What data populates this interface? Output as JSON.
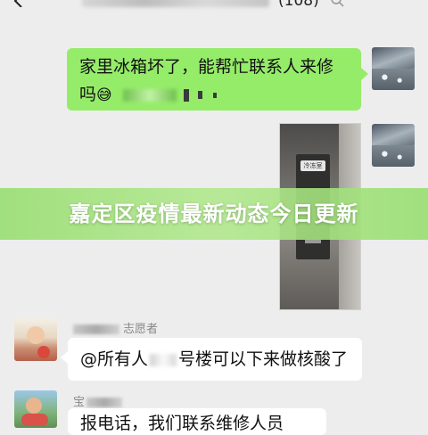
{
  "header": {
    "member_count": "(108)",
    "icons": {
      "back": "chevron-left-icon",
      "search": "search-icon"
    }
  },
  "messages": [
    {
      "side": "right",
      "type": "text",
      "line1": "家里冰箱坏了，能帮忙联系人来修",
      "line2": "吗",
      "emoji": "😅"
    },
    {
      "side": "right",
      "type": "image",
      "image_label": "冷冻室"
    },
    {
      "side": "left",
      "type": "text",
      "sender": "志愿者",
      "part1": "@所有人",
      "part2": "号楼可以下来做核酸了"
    },
    {
      "side": "left",
      "type": "text",
      "sender": "宝",
      "part1": "报电话，我们联系维修人员"
    }
  ],
  "banner": {
    "title": "嘉定区疫情最新动态今日更新"
  },
  "colors": {
    "background": "#ededed",
    "own_bubble": "#95ec69",
    "other_bubble": "#ffffff",
    "banner": "#96de6e"
  }
}
